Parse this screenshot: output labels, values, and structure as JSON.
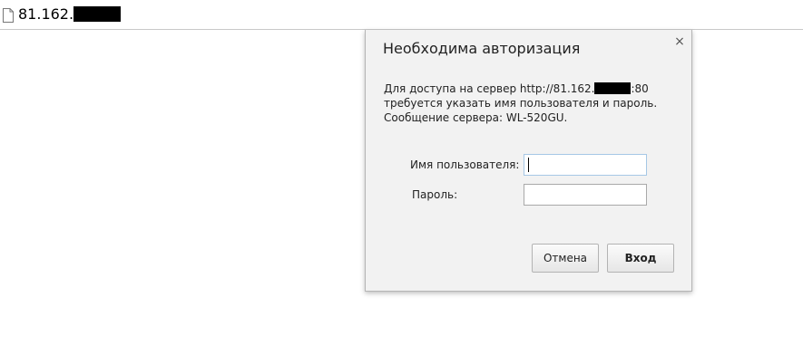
{
  "omnibox": {
    "url_prefix": "81.162.",
    "page_icon": "page-icon"
  },
  "dialog": {
    "title": "Необходима авторизация",
    "close_icon": "close-icon",
    "close_glyph": "×",
    "message_line1_prefix": "Для доступа на сервер http://81.162.",
    "message_line1_suffix": ":80",
    "message_line2": "требуется указать имя пользователя и пароль.",
    "message_line3": "Сообщение сервера: WL-520GU.",
    "username_label": "Имя пользователя:",
    "username_value": "",
    "password_label": "Пароль:",
    "password_value": "",
    "cancel_label": "Отмена",
    "login_label": "Вход"
  }
}
